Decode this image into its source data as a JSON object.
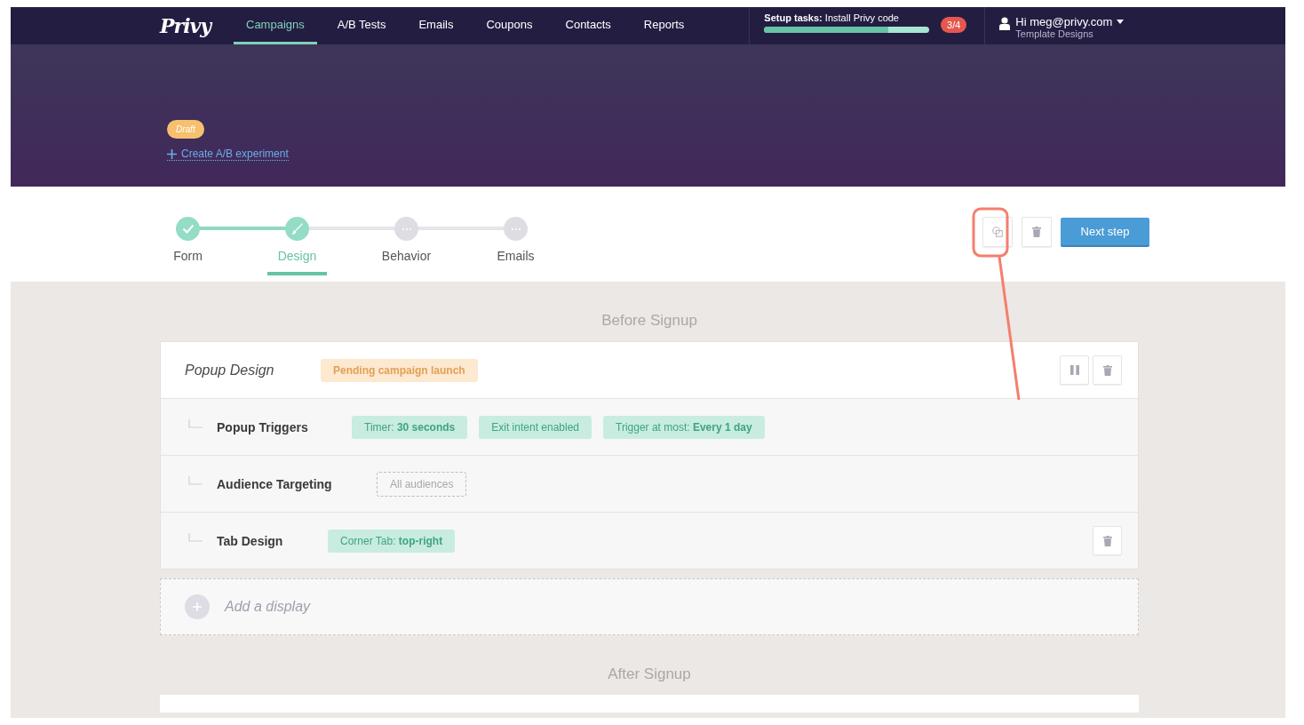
{
  "nav": {
    "logo": "Privy",
    "tabs": [
      {
        "label": "Campaigns",
        "selected": true
      },
      {
        "label": "A/B Tests",
        "selected": false
      },
      {
        "label": "Emails",
        "selected": false
      },
      {
        "label": "Coupons",
        "selected": false
      },
      {
        "label": "Contacts",
        "selected": false
      },
      {
        "label": "Reports",
        "selected": false
      }
    ],
    "setup": {
      "label": "Setup tasks:",
      "task": "Install Privy code",
      "level": 0.75,
      "count": "3/4"
    },
    "user": {
      "greeting": "Hi meg@privy.com",
      "account": "Template Designs"
    }
  },
  "hero": {
    "status": "Draft",
    "ab_link": "Create A/B experiment"
  },
  "steps": [
    {
      "label": "Form",
      "completed": true,
      "selected": false
    },
    {
      "label": "Design",
      "completed": false,
      "selected": true
    },
    {
      "label": "Behavior",
      "completed": false,
      "selected": false
    },
    {
      "label": "Emails",
      "completed": false,
      "selected": false
    }
  ],
  "toolbar": {
    "next_button": "Next step"
  },
  "sections": [
    {
      "title": "Before Signup",
      "display": {
        "title": "Popup Design",
        "status": "Pending campaign launch",
        "pausable": true,
        "deletable": true,
        "rows": [
          {
            "label": "Popup Triggers",
            "deletable": false,
            "tags": [
              {
                "kind": "filled",
                "text": "Timer: **30 seconds**"
              },
              {
                "kind": "filled",
                "text": "Exit intent enabled"
              },
              {
                "kind": "filled",
                "text": "Trigger at most: **Every 1 day**"
              }
            ]
          },
          {
            "label": "Audience Targeting",
            "deletable": false,
            "tags": [
              {
                "kind": "dashed",
                "text": "All audiences"
              }
            ]
          },
          {
            "label": "Tab Design",
            "deletable": true,
            "tags": [
              {
                "kind": "filled",
                "text": "Corner Tab: **top-right**"
              }
            ]
          }
        ]
      },
      "add_label": "Add a display"
    },
    {
      "title": "After Signup"
    }
  ]
}
